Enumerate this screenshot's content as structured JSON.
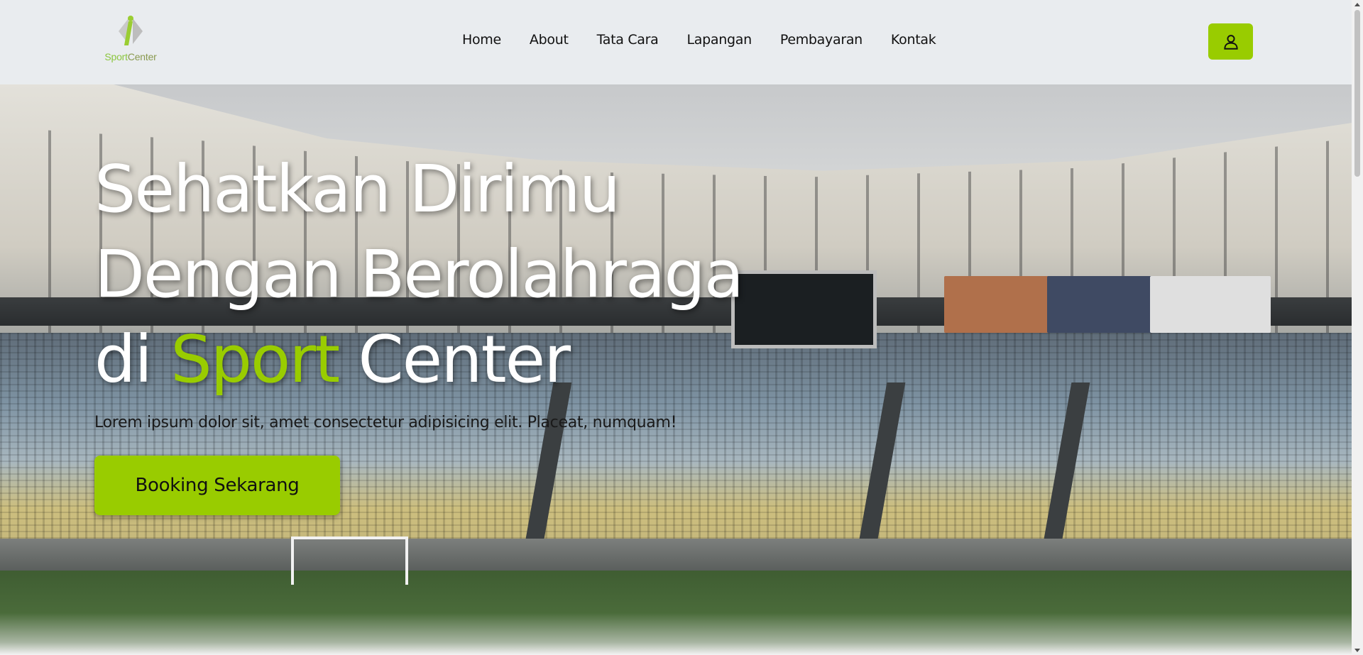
{
  "brand": {
    "logo_word_1": "Sport",
    "logo_word_2": "Center",
    "accent_color": "#99cc00"
  },
  "nav": {
    "items": [
      {
        "label": "Home"
      },
      {
        "label": "About"
      },
      {
        "label": "Tata Cara"
      },
      {
        "label": "Lapangan"
      },
      {
        "label": "Pembayaran"
      },
      {
        "label": "Kontak"
      }
    ],
    "user_icon": "user-icon"
  },
  "hero": {
    "title_line1": "Sehatkan Dirimu",
    "title_line2": "Dengan Berolahraga",
    "title_line3_prefix": "di ",
    "title_line3_accent": "Sport",
    "title_line3_suffix": " Center",
    "subtitle": "Lorem ipsum dolor sit, amet consectetur adipisicing elit. Placeat, numquam!",
    "cta_label": "Booking Sekarang"
  }
}
